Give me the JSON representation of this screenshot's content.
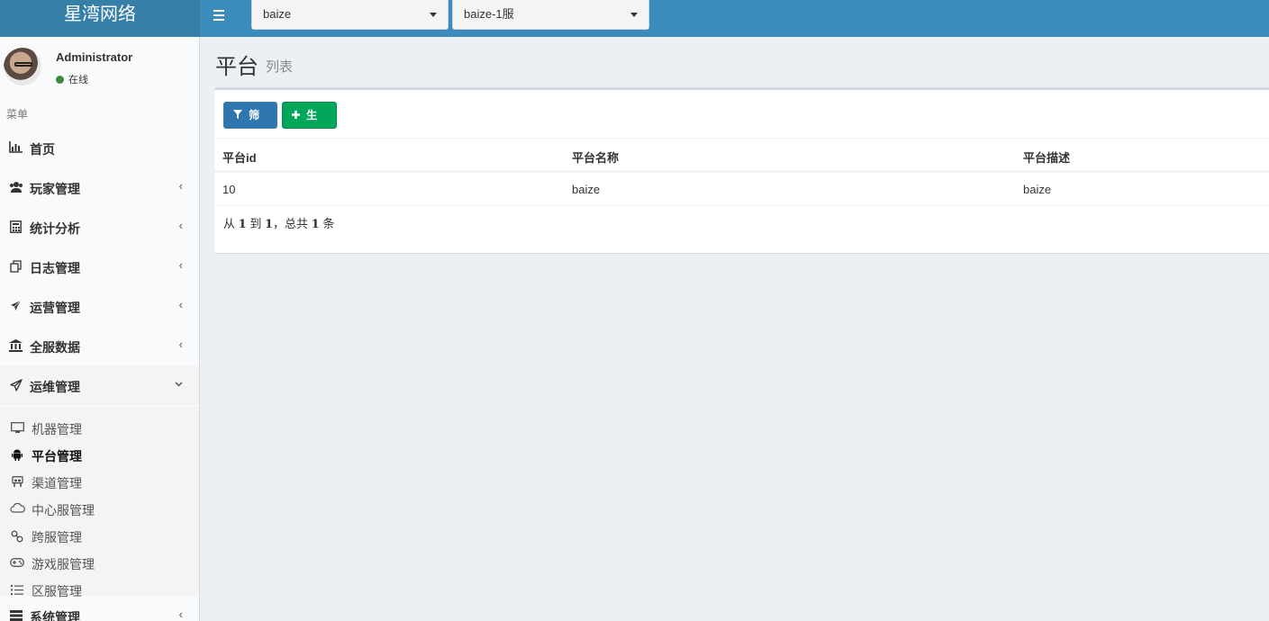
{
  "header": {
    "logo": "星湾网络",
    "platform_select": "baize",
    "server_select": "baize-1服"
  },
  "user": {
    "name": "Administrator",
    "status": "在线"
  },
  "sidebar": {
    "menu_header": "菜单",
    "items": [
      {
        "label": "首页",
        "icon": "bar-chart-icon"
      },
      {
        "label": "玩家管理",
        "icon": "users-icon"
      },
      {
        "label": "统计分析",
        "icon": "calculator-icon"
      },
      {
        "label": "日志管理",
        "icon": "copy-icon"
      },
      {
        "label": "运营管理",
        "icon": "plane-icon"
      },
      {
        "label": "全服数据",
        "icon": "bank-icon"
      },
      {
        "label": "运维管理",
        "icon": "paper-plane-icon"
      },
      {
        "label": "系统管理",
        "icon": "server-icon"
      }
    ],
    "submenu": [
      {
        "label": "机器管理",
        "icon": "desktop-icon"
      },
      {
        "label": "平台管理",
        "icon": "android-icon"
      },
      {
        "label": "渠道管理",
        "icon": "slideshare-icon"
      },
      {
        "label": "中心服管理",
        "icon": "cloud-icon"
      },
      {
        "label": "跨服管理",
        "icon": "link-icon"
      },
      {
        "label": "游戏服管理",
        "icon": "gamepad-icon"
      },
      {
        "label": "区服管理",
        "icon": "list-icon"
      }
    ]
  },
  "page": {
    "title": "平台",
    "subtitle": "列表"
  },
  "toolbar": {
    "filter_label": "筛选",
    "generate_label": "生成"
  },
  "table": {
    "headers": [
      "平台id",
      "平台名称",
      "平台描述"
    ],
    "rows": [
      [
        "10",
        "baize",
        "baize"
      ]
    ]
  },
  "pagination": {
    "prefix": "从",
    "from": "1",
    "to_word": "到",
    "to": "1",
    "total_word": "，总共",
    "total": "1",
    "suffix": "条"
  },
  "colors": {
    "header": "#3c8dbc",
    "filter_button": "#2f76b0",
    "generate_button": "#00a65a"
  }
}
